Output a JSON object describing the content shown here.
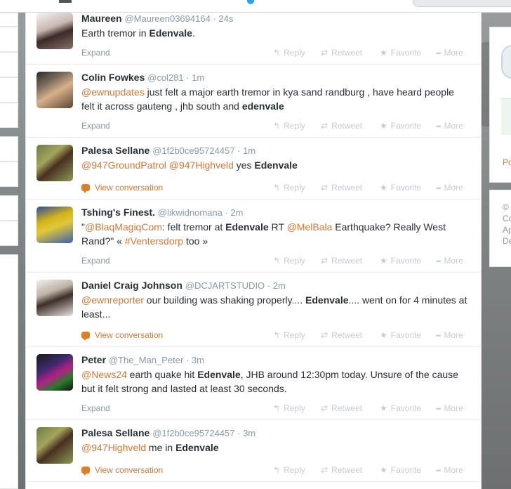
{
  "tweets": [
    {
      "fullname": "Maureen",
      "username": "@Maureen03694164",
      "time": "24s",
      "segments": [
        {
          "t": "Earth tremor in "
        },
        {
          "t": "Edenvale",
          "b": true
        },
        {
          "t": "."
        }
      ],
      "footer": "Expand"
    },
    {
      "fullname": "Colin Fowkes",
      "username": "@col281",
      "time": "1m",
      "segments": [
        {
          "t": "@ewnupdates",
          "m": true
        },
        {
          "t": " just felt a major earth tremor in kya sand randburg , have heard people felt it across gauteng , jhb south and "
        },
        {
          "t": "edenvale",
          "b": true
        }
      ],
      "footer": "Expand"
    },
    {
      "fullname": "Palesa Sellane",
      "username": "@1f2b0ce95724457",
      "time": "1m",
      "segments": [
        {
          "t": "@947GroundPatrol",
          "m": true
        },
        {
          "t": " "
        },
        {
          "t": "@947Highveld",
          "m": true
        },
        {
          "t": " yes "
        },
        {
          "t": "Edenvale",
          "b": true
        }
      ],
      "footer": "View conversation"
    },
    {
      "fullname": "Tshing's Finest.",
      "username": "@likwidnomana",
      "time": "2m",
      "segments": [
        {
          "t": "\""
        },
        {
          "t": "@BlaqMagiqCom",
          "m": true
        },
        {
          "t": ": felt tremor at "
        },
        {
          "t": "Edenvale",
          "b": true
        },
        {
          "t": " RT "
        },
        {
          "t": "@MelBala",
          "m": true
        },
        {
          "t": " Earthquake? Really West Rand?\" « "
        },
        {
          "t": "#Ventersdorp",
          "m": true
        },
        {
          "t": " too »"
        }
      ],
      "footer": "Expand"
    },
    {
      "fullname": "Daniel Craig Johnson",
      "username": "@DCJARTSTUDIO",
      "time": "2m",
      "segments": [
        {
          "t": "@ewnreporter",
          "m": true
        },
        {
          "t": " our building was shaking properly.... "
        },
        {
          "t": "Edenvale",
          "b": true
        },
        {
          "t": ".... went on for 4 minutes at least..."
        }
      ],
      "footer": "View conversation"
    },
    {
      "fullname": "Peter",
      "username": "@The_Man_Peter",
      "time": "3m",
      "segments": [
        {
          "t": "@News24",
          "m": true
        },
        {
          "t": " earth quake hit "
        },
        {
          "t": "Edenvale",
          "b": true
        },
        {
          "t": ", JHB around 12:30pm today. Unsure of the cause but it felt strong and lasted at least 30 seconds."
        }
      ],
      "footer": "Expand"
    },
    {
      "fullname": "Palesa Sellane",
      "username": "@1f2b0ce95724457",
      "time": "3m",
      "segments": [
        {
          "t": "@947Highveld",
          "m": true
        },
        {
          "t": " me in "
        },
        {
          "t": "Edenvale",
          "b": true
        }
      ],
      "footer": "View conversation"
    }
  ],
  "actions": {
    "reply": "Reply",
    "retweet": "Retweet",
    "favorite": "Favorite",
    "more": "More"
  },
  "right_panel": {
    "link": "Po",
    "footer_lines": [
      "©",
      "Co",
      "Ap",
      "De"
    ]
  },
  "icons": {
    "reply": "reply-arrow-icon",
    "retweet": "retweet-icon",
    "favorite": "star-icon",
    "more": "ellipsis-icon",
    "conversation": "speech-bubble-icon"
  },
  "colors": {
    "mention": "#d07a3a",
    "muted": "#8899a6",
    "action": "#c4ccd3"
  }
}
